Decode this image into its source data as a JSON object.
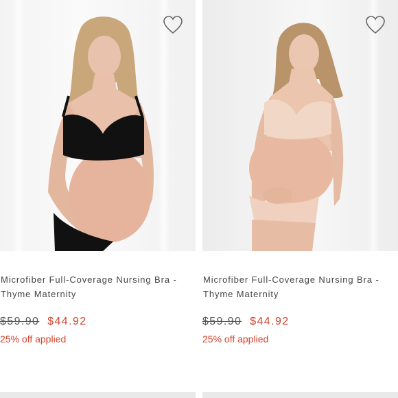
{
  "products": [
    {
      "title_line1": "Microfiber Full-Coverage Nursing Bra -",
      "title_line2": "Thyme Maternity",
      "original_price": "$59.90",
      "sale_price": "$44.92",
      "promo": "25% off applied",
      "favorite_icon": "heart-outline-icon",
      "variant": "black"
    },
    {
      "title_line1": "Microfiber Full-Coverage Nursing Bra -",
      "title_line2": "Thyme Maternity",
      "original_price": "$59.90",
      "sale_price": "$44.92",
      "promo": "25% off applied",
      "favorite_icon": "heart-outline-icon",
      "variant": "nude"
    }
  ],
  "colors": {
    "sale": "#d4422c",
    "text": "#444444"
  }
}
